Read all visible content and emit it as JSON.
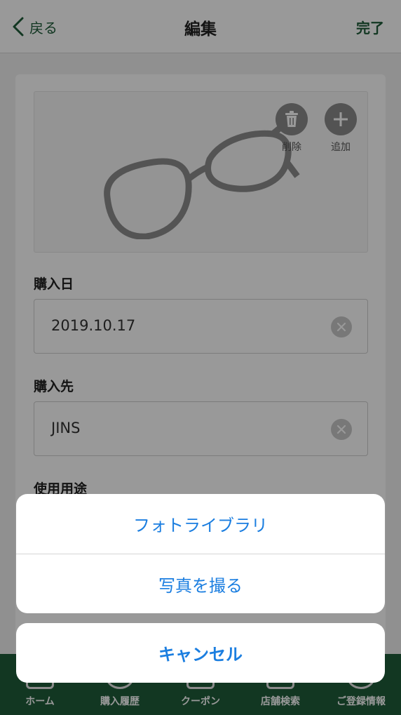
{
  "navbar": {
    "back_label": "戻る",
    "title": "編集",
    "done_label": "完了"
  },
  "photo": {
    "delete_label": "削除",
    "add_label": "追加"
  },
  "fields": [
    {
      "label": "購入日",
      "value": "2019.10.17"
    },
    {
      "label": "購入先",
      "value": "JINS"
    },
    {
      "label": "使用用途"
    }
  ],
  "action_sheet": {
    "options": [
      "フォトライブラリ",
      "写真を撮る"
    ],
    "cancel_label": "キャンセル"
  },
  "tabbar": {
    "items": [
      "ホーム",
      "購入履歴",
      "クーポン",
      "店舗検索",
      "ご登録情報"
    ]
  },
  "colors": {
    "brand_green": "#1f5c3a",
    "action_blue": "#1b7ee0"
  }
}
